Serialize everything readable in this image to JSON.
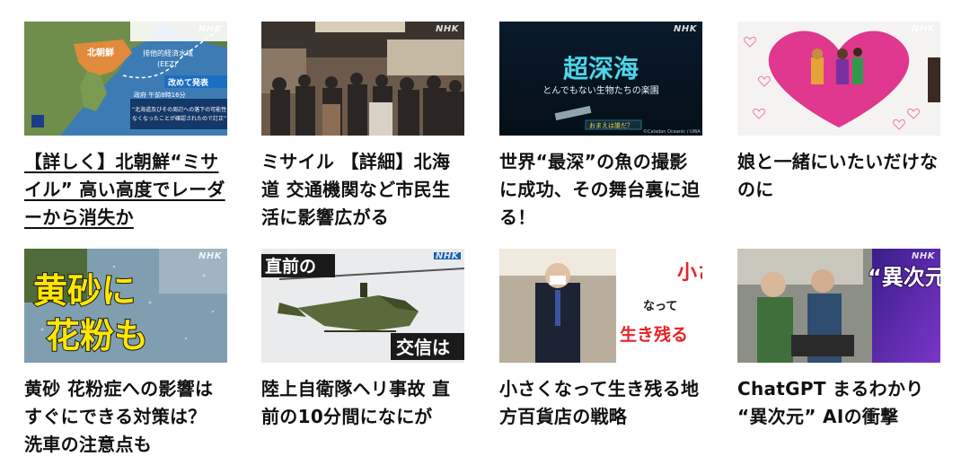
{
  "brand": "NHK",
  "articles": [
    {
      "title": "【詳しく】北朝鮮“ミサイル” 高い高度でレーダーから消失か",
      "underlined": true,
      "thumb": {
        "label_nk": "北朝鮮",
        "label_eez": "排他的経済水域",
        "label_eez2": "(EEZ)",
        "banner": "改めて発表",
        "time": "政府 午前8時16分",
        "caption1": "“北海道及びその周辺への落下の可能性",
        "caption2": "なくなったことが確認されたので訂正”"
      }
    },
    {
      "title": "ミサイル 【詳細】北海道 交通機関など市民生活に影響広がる",
      "underlined": false,
      "thumb": {}
    },
    {
      "title": "世界“最深”の魚の撮影に成功、その舞台裏に迫る！",
      "underlined": false,
      "thumb": {
        "big": "超深海",
        "sub": "とんでもない生物たちの楽園",
        "tag": "おまえは誰だ？",
        "credit": "©Caladan Oceanic / UWA"
      }
    },
    {
      "title": "娘と一緒にいたいだけなのに",
      "underlined": false,
      "thumb": {}
    },
    {
      "title": "黄砂 花粉症への影響は すぐにできる対策は？ 洗車の注意点も",
      "underlined": false,
      "thumb": {
        "line1": "黄砂に",
        "line2": "花粉も"
      }
    },
    {
      "title": "陸上自衛隊ヘリ事故 直前の10分間になにが",
      "underlined": false,
      "thumb": {
        "top": "直前の",
        "bottom": "交信は"
      }
    },
    {
      "title": "小さくなって生き残る地方百貨店の戦略",
      "underlined": false,
      "thumb": {
        "v1": "小さく",
        "v2": "なって",
        "v3": "生き残る"
      }
    },
    {
      "title": "ChatGPT まるわかり “異次元” AIの衝撃",
      "underlined": false,
      "thumb": {
        "big": "“異次元”"
      }
    }
  ],
  "colors": {
    "text": "#111111",
    "accent_yellow": "#ffe600",
    "accent_red": "#e8232a"
  }
}
